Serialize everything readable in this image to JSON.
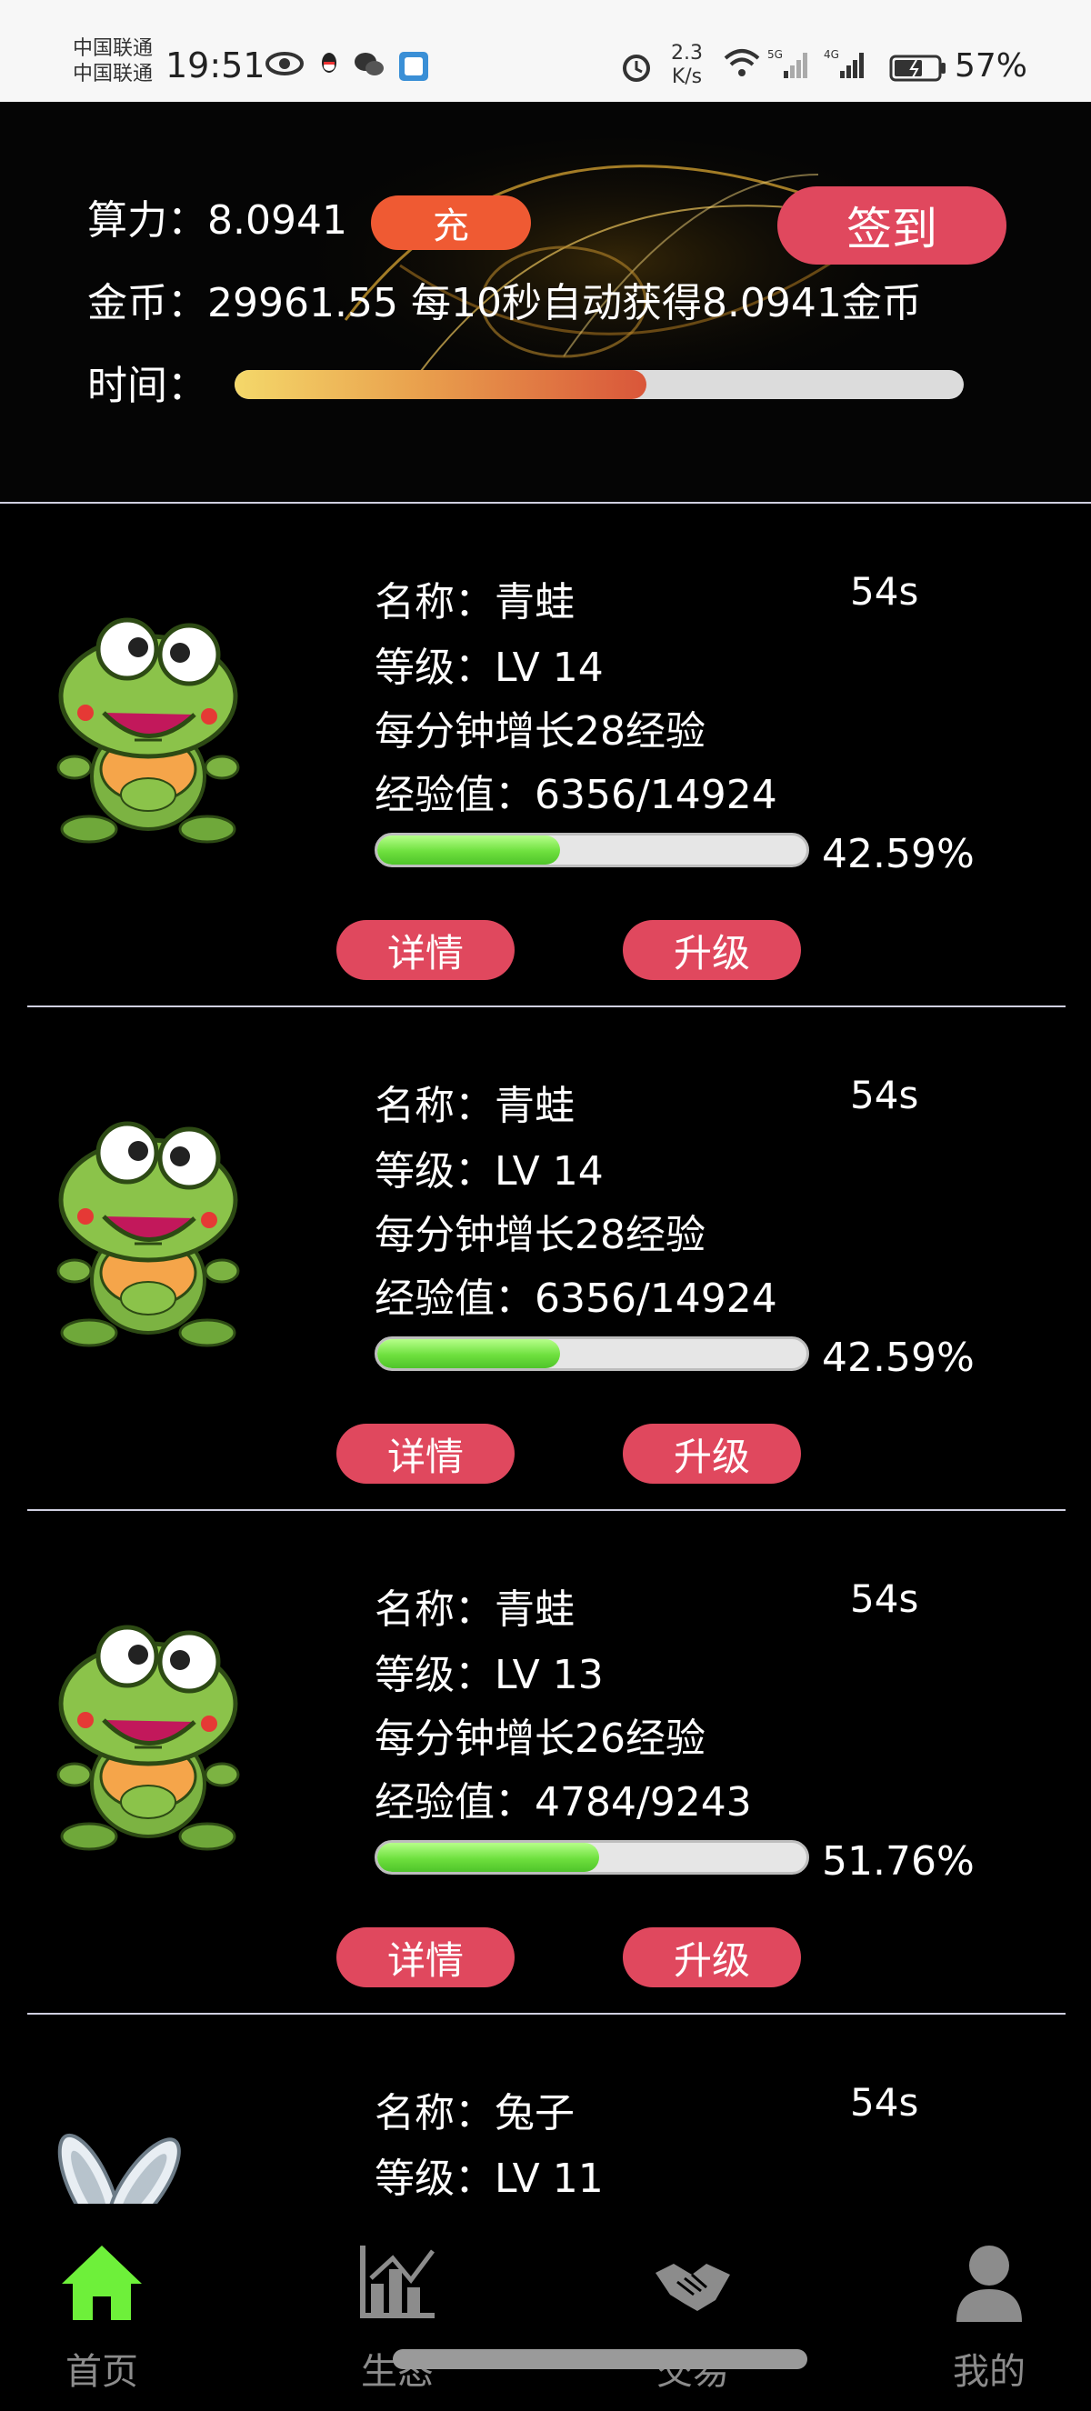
{
  "status_bar": {
    "carrier_1": "中国联通",
    "carrier_2": "中国联通",
    "time": "19:51",
    "net_speed_value": "2.3",
    "net_speed_unit": "K/s",
    "signal_1": "5G",
    "signal_2": "4G",
    "battery": "57%",
    "icons": [
      "eye-icon",
      "qq-icon",
      "wechat-icon",
      "app-icon",
      "alarm-icon",
      "wifi-icon",
      "signal-icon",
      "battery-icon"
    ]
  },
  "header": {
    "power_label": "算力：",
    "power_value": "8.0941",
    "recharge_label": "充",
    "signin_label": "签到",
    "coins_label": "金币：",
    "coins_value": "29961.55",
    "coins_auto": "每10秒自动获得8.0941金币",
    "time_label": "时间：",
    "time_progress": 0.565
  },
  "pets": [
    {
      "name_label": "名称：",
      "name": "青蛙",
      "level_label": "等级：",
      "level": "LV 14",
      "growth": "每分钟增长28经验",
      "exp_label": "经验值：",
      "exp": "6356/14924",
      "exp_progress": 0.4259,
      "exp_percent": "42.59%",
      "countdown": "54s",
      "detail_label": "详情",
      "upgrade_label": "升级",
      "image": "frog"
    },
    {
      "name_label": "名称：",
      "name": "青蛙",
      "level_label": "等级：",
      "level": "LV 14",
      "growth": "每分钟增长28经验",
      "exp_label": "经验值：",
      "exp": "6356/14924",
      "exp_progress": 0.4259,
      "exp_percent": "42.59%",
      "countdown": "54s",
      "detail_label": "详情",
      "upgrade_label": "升级",
      "image": "frog"
    },
    {
      "name_label": "名称：",
      "name": "青蛙",
      "level_label": "等级：",
      "level": "LV 13",
      "growth": "每分钟增长26经验",
      "exp_label": "经验值：",
      "exp": "4784/9243",
      "exp_progress": 0.5176,
      "exp_percent": "51.76%",
      "countdown": "54s",
      "detail_label": "详情",
      "upgrade_label": "升级",
      "image": "frog"
    },
    {
      "name_label": "名称：",
      "name": "兔子",
      "level_label": "等级：",
      "level": "LV 11",
      "countdown": "54s",
      "image": "rabbit"
    }
  ],
  "nav": {
    "items": [
      {
        "label": "首页",
        "icon": "home-icon",
        "active": true
      },
      {
        "label": "生态",
        "icon": "chart-icon",
        "active": false
      },
      {
        "label": "交易",
        "icon": "handshake-icon",
        "active": false
      },
      {
        "label": "我的",
        "icon": "user-icon",
        "active": false
      }
    ]
  },
  "colors": {
    "accent_pink": "#e0485e",
    "recharge_orange": "#ef5a33",
    "exp_green": "#6ee03e",
    "active_nav": "#6ef03a"
  }
}
